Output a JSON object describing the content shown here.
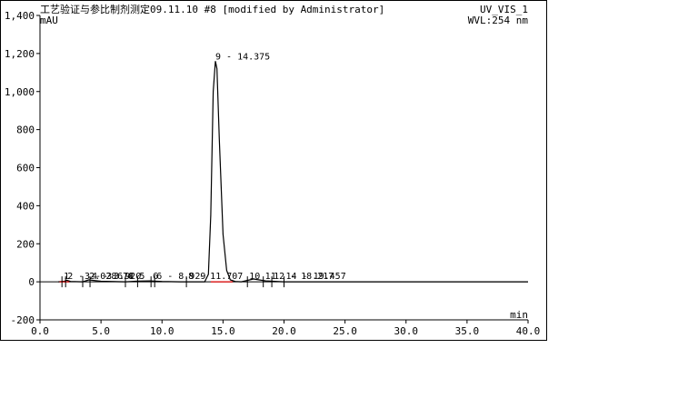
{
  "header": {
    "title": "工艺验证与参比制剂测定09.11.10 #8 [modified by Administrator]",
    "channel": "UV_VIS_1",
    "y_unit": "mAU",
    "wavelength": "WVL:254 nm",
    "x_unit": "min"
  },
  "chart_data": {
    "type": "line",
    "xlabel": "min",
    "ylabel": "mAU",
    "xlim": [
      0,
      40
    ],
    "ylim": [
      -200,
      1400
    ],
    "x_ticks": [
      "0.0",
      "5.0",
      "10.0",
      "15.0",
      "20.0",
      "25.0",
      "30.0",
      "35.0",
      "40.0"
    ],
    "y_ticks": [
      "-200",
      "0",
      "200",
      "400",
      "600",
      "800",
      "1,000",
      "1,200",
      "1,400"
    ],
    "x_tick_values": [
      0,
      5,
      10,
      15,
      20,
      25,
      30,
      35,
      40
    ],
    "y_tick_values": [
      -200,
      0,
      200,
      400,
      600,
      800,
      1000,
      1200,
      1400
    ],
    "series": [
      {
        "color": "#000000",
        "x": [
          1.5,
          2.0,
          2.2,
          2.5,
          3.5,
          4.0,
          5.0,
          7.0,
          8.0,
          9.0,
          10.0,
          11.5,
          12.5,
          13.5,
          13.8,
          14.0,
          14.2,
          14.375,
          14.5,
          14.7,
          15.0,
          15.3,
          15.6,
          16.0,
          16.5,
          17.5,
          18.5,
          20.0,
          22.0,
          24.0,
          40.0
        ],
        "y": [
          0,
          3,
          8,
          2,
          0,
          10,
          3,
          0,
          4,
          5,
          2,
          0,
          0,
          0,
          40,
          350,
          1000,
          1160,
          1120,
          750,
          250,
          60,
          10,
          2,
          0,
          15,
          5,
          0,
          0,
          0,
          0
        ]
      }
    ],
    "annotations": [
      {
        "x": 1.8,
        "y": 30,
        "text": "1"
      },
      {
        "x": 2.1,
        "y": 30,
        "text": "2 - 2.028"
      },
      {
        "x": 3.5,
        "y": 30,
        "text": "3 - 3.678"
      },
      {
        "x": 4.1,
        "y": 30,
        "text": "4 - 3.920"
      },
      {
        "x": 7.0,
        "y": 30,
        "text": "4"
      },
      {
        "x": 8.0,
        "y": 30,
        "text": "5"
      },
      {
        "x": 9.1,
        "y": 30,
        "text": "6"
      },
      {
        "x": 9.4,
        "y": 30,
        "text": "6 - 8.929"
      },
      {
        "x": 12.0,
        "y": 30,
        "text": "8 - 11.707"
      },
      {
        "x": 14.375,
        "y": 1160,
        "text": "9 - 14.375"
      },
      {
        "x": 17.0,
        "y": 30,
        "text": "10"
      },
      {
        "x": 18.3,
        "y": 30,
        "text": "11"
      },
      {
        "x": 19.0,
        "y": 30,
        "text": "12 - 18.217"
      },
      {
        "x": 20.0,
        "y": 30,
        "text": "14 - 19.457"
      }
    ],
    "grid": false,
    "baseline_color": "#e00000",
    "baseline_y": 0
  }
}
